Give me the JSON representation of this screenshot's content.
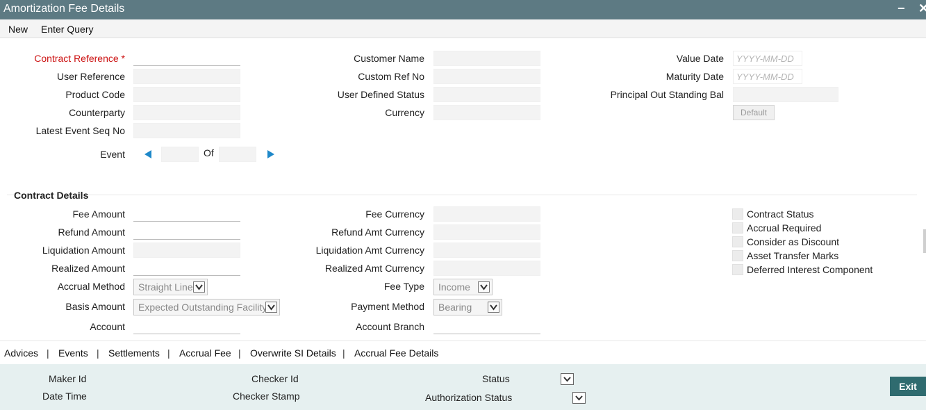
{
  "window": {
    "title": "Amortization Fee Details",
    "minimize_glyph": "−",
    "close_glyph": "✕"
  },
  "menu": {
    "new": "New",
    "enter_query": "Enter Query"
  },
  "header": {
    "contract_reference": "Contract Reference *",
    "user_reference": "User Reference",
    "product_code": "Product Code",
    "counterparty": "Counterparty",
    "latest_event_seq_no": "Latest Event Seq No",
    "event": "Event",
    "event_of": "Of",
    "customer_name": "Customer Name",
    "custom_ref_no": "Custom Ref No",
    "user_defined_status": "User Defined Status",
    "currency": "Currency",
    "value_date": "Value Date",
    "value_date_placeholder": "YYYY-MM-DD",
    "maturity_date": "Maturity Date",
    "maturity_date_placeholder": "YYYY-MM-DD",
    "principal_outstanding_bal": "Principal Out Standing Bal",
    "default_button": "Default"
  },
  "contract_details": {
    "section_title": "Contract Details",
    "fee_amount": "Fee Amount",
    "refund_amount": "Refund Amount",
    "liquidation_amount": "Liquidation Amount",
    "realized_amount": "Realized Amount",
    "accrual_method": "Accrual Method",
    "accrual_method_value": "Straight Line",
    "basis_amount": "Basis Amount",
    "basis_amount_value": "Expected Outstanding Facility",
    "account": "Account",
    "fee_currency": "Fee Currency",
    "refund_amt_currency": "Refund Amt Currency",
    "liquidation_amt_currency": "Liquidation Amt Currency",
    "realized_amt_currency": "Realized Amt Currency",
    "fee_type": "Fee Type",
    "fee_type_value": "Income",
    "payment_method": "Payment Method",
    "payment_method_value": "Bearing",
    "account_branch": "Account Branch",
    "checkboxes": [
      "Contract Status",
      "Accrual Required",
      "Consider as Discount",
      "Asset Transfer Marks",
      "Deferred Interest Component"
    ]
  },
  "tabs": [
    "Advices",
    "Events",
    "Settlements",
    "Accrual Fee",
    "Overwrite SI Details",
    "Accrual Fee Details"
  ],
  "footer": {
    "maker_id": "Maker Id",
    "date_time": "Date Time",
    "checker_id": "Checker Id",
    "checker_stamp": "Checker Stamp",
    "status": "Status",
    "authorization_status": "Authorization Status",
    "exit_button": "Exit"
  },
  "colors": {
    "titlebar": "#5d7a83",
    "required": "#cc1111",
    "nav_arrow": "#1e88c9",
    "exit_button": "#2f6b6f",
    "footer_bg": "#e6f0f0"
  },
  "icons": {
    "prev": "triangle-left-icon",
    "next": "triangle-right-icon",
    "dropdown": "chevron-down-icon"
  }
}
